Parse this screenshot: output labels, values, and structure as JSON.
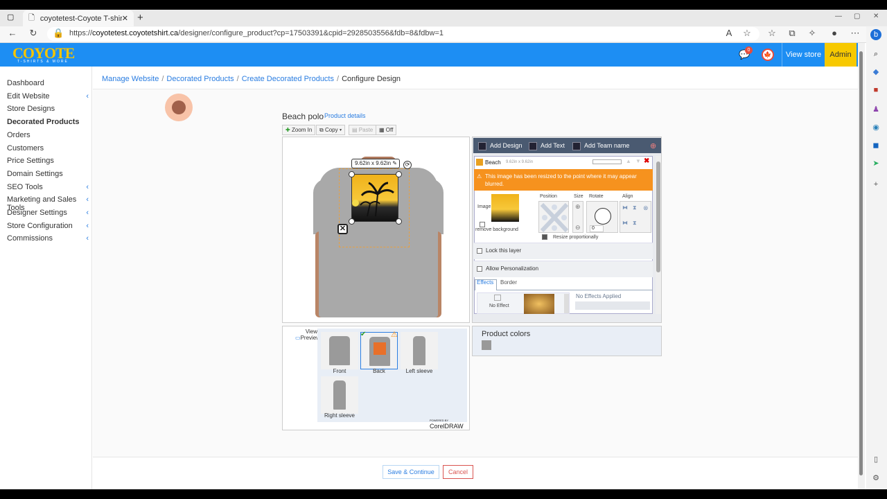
{
  "browser": {
    "tab_title": "coyotetest-Coyote T-shirts Config",
    "url_prefix": "https://",
    "url_host": "coyotetest.coyotetshirt.ca",
    "url_path": "/designer/configure_product?cp=17503391&cpid=2928503556&fdb=8&fdbw=1"
  },
  "header": {
    "logo_text": "COYOTE",
    "logo_sub": "T-SHIRTS & MORE",
    "notification_count": "0",
    "view_store": "View store",
    "admin": "Admin"
  },
  "sidebar": {
    "items": [
      {
        "label": "Dashboard",
        "arrow": ""
      },
      {
        "label": "Edit Website",
        "arrow": "‹"
      },
      {
        "label": "Store Designs",
        "arrow": ""
      },
      {
        "label": "Decorated Products",
        "arrow": ""
      },
      {
        "label": "Orders",
        "arrow": ""
      },
      {
        "label": "Customers",
        "arrow": ""
      },
      {
        "label": "Price Settings",
        "arrow": ""
      },
      {
        "label": "Domain Settings",
        "arrow": ""
      },
      {
        "label": "SEO Tools",
        "arrow": "‹"
      },
      {
        "label": "Marketing and Sales Tools",
        "arrow": "‹"
      },
      {
        "label": "Designer Settings",
        "arrow": "‹"
      },
      {
        "label": "Store Configuration",
        "arrow": "‹"
      },
      {
        "label": "Commissions",
        "arrow": "‹"
      }
    ]
  },
  "breadcrumb": {
    "items": [
      "Manage Website",
      "Decorated Products",
      "Create Decorated Products"
    ],
    "current": "Configure Design"
  },
  "product": {
    "title": "Beach polo",
    "details_link": "Product details"
  },
  "toolbar": {
    "zoom_in": "Zoom In",
    "copy": "Copy",
    "paste": "Paste",
    "off": "Off"
  },
  "design": {
    "size_label": "9.62in x 9.62in"
  },
  "views": {
    "label_views": "Views",
    "label_preview": "Preview",
    "items": [
      {
        "label": "Front"
      },
      {
        "label": "Back"
      },
      {
        "label": "Left sleeve"
      },
      {
        "label": "Right sleeve"
      }
    ],
    "powered_by": "POWERED BY",
    "brand": "CorelDRAW"
  },
  "panel": {
    "tabs": [
      "Add Design",
      "Add Text",
      "Add Team name"
    ],
    "layer_name": "Beach",
    "layer_size": "9.62in x 9.62in",
    "warning": "This image has been resized to the point where it may appear blurred.",
    "image_label": "Image",
    "remove_background": "remove background",
    "position": "Position",
    "size": "Size",
    "rotate": "Rotate",
    "align": "Align",
    "rotate_value": "0",
    "resize_proportionally": "Resize proportionally",
    "lock_layer": "Lock this layer",
    "allow_personalization": "Allow Personalization",
    "effects_tab": "Effects",
    "border_tab": "Border",
    "no_effect": "No Effect",
    "no_effects_applied": "No Effects Applied"
  },
  "product_colors": {
    "label": "Product colors",
    "swatch": "#999999"
  },
  "actions": {
    "save": "Save & Continue",
    "cancel": "Cancel"
  },
  "colors": {
    "header": "#1d8ef3",
    "admin": "#f7c900",
    "link": "#2a7de1",
    "warning": "#f6921e",
    "danger": "#d9534f"
  }
}
